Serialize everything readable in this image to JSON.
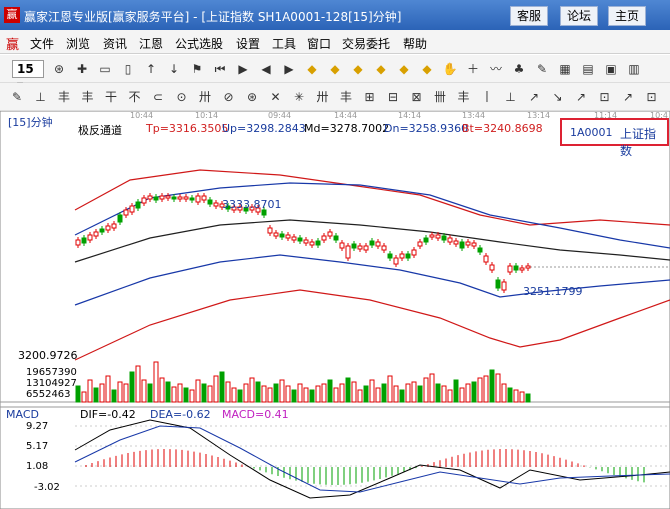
{
  "window": {
    "title": "赢家江恩专业版[赢家服务平台] - [上证指数  SH1A0001-128[15]分钟]",
    "logo_char": "赢",
    "buttons": [
      "客服",
      "论坛",
      "主页"
    ]
  },
  "menu": [
    "文件",
    "浏览",
    "资讯",
    "江恩",
    "公式选股",
    "设置",
    "工具",
    "窗口",
    "交易委托",
    "帮助"
  ],
  "toolbar": {
    "period": "15",
    "row1_icons": [
      "compass-icon",
      "cross-icon",
      "rect-icon",
      "rect2-icon",
      "up-arrow-icon",
      "down-arrow-icon",
      "flag-icon",
      "first-icon",
      "prev-icon",
      "play-left-icon",
      "play-right-icon",
      "diamond1-icon",
      "diamond2-icon",
      "diamond3-icon",
      "diamond4-icon",
      "diamond5-icon",
      "diamond6-icon",
      "hand-icon",
      "plus-icon",
      "wave-icon",
      "tshirt-icon",
      "note-icon",
      "calendar-icon",
      "grid-icon",
      "save-icon",
      "layout-icon"
    ],
    "row2_icons": [
      "pen-icon",
      "tool1-icon",
      "tool2-icon",
      "tool3-icon",
      "tool4-icon",
      "tool5-icon",
      "tool6-icon",
      "tool7-icon",
      "tool8-icon",
      "tool9-icon",
      "tool10-icon",
      "tool11-icon",
      "tool12-icon",
      "tool13-icon",
      "tool14-icon",
      "tool15-icon",
      "tool16-icon",
      "tool17-icon",
      "tool18-icon",
      "tool19-icon",
      "tool20-icon",
      "tool21-icon",
      "tool22-icon",
      "tool23-icon",
      "tool24-icon",
      "tool25-icon",
      "tool26-icon",
      "tool27-icon"
    ]
  },
  "chart_header": {
    "period": "[15]分钟",
    "indicator": "极反通道",
    "tp": "Tp=3316.3505",
    "up": "Up=3298.2843",
    "md": "Md=3278.7002",
    "dn": "Dn=3258.9360",
    "bt": "Bt=3240.8698",
    "code": "1A0001",
    "name": "上证指数"
  },
  "time_axis": [
    "10:44",
    "10:14",
    "09:44",
    "14:44",
    "14:14",
    "13:44",
    "13:14",
    "11:14",
    "10:4"
  ],
  "annotations": {
    "high": "3333.8701",
    "low": "3251.1799",
    "min_price": "3200.9726"
  },
  "volume_labels": [
    "19657390",
    "13104927",
    "6552463"
  ],
  "macd": {
    "title": "MACD",
    "dif": "DIF=-0.42",
    "dea": "DEA=-0.62",
    "macd": "MACD=0.41",
    "levels": [
      "9.27",
      "5.17",
      "1.08",
      "-3.02"
    ]
  },
  "colors": {
    "up": "#e00000",
    "down": "#00a000",
    "blue_line": "#1838a8",
    "red_line": "#d01818",
    "header_red": "#d02020",
    "header_blue": "#1a3c9e"
  }
}
